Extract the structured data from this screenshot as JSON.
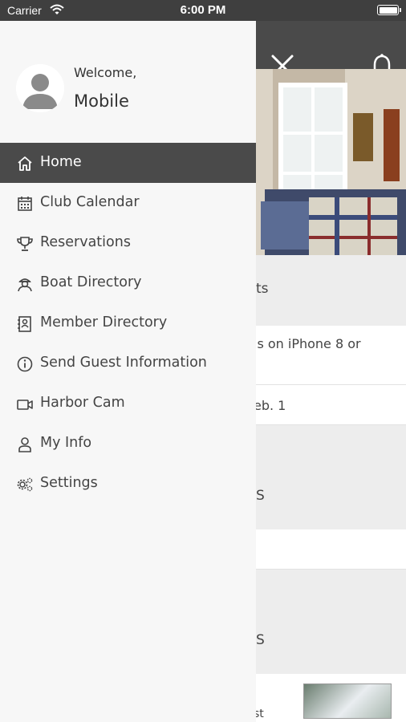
{
  "status_bar": {
    "carrier": "Carrier",
    "time": "6:00 PM"
  },
  "drawer": {
    "welcome": "Welcome,",
    "username": "Mobile",
    "items": [
      {
        "label": "Home",
        "icon": "home-icon",
        "active": true
      },
      {
        "label": "Club Calendar",
        "icon": "calendar-icon"
      },
      {
        "label": "Reservations",
        "icon": "trophy-icon"
      },
      {
        "label": "Boat Directory",
        "icon": "captain-icon"
      },
      {
        "label": "Member Directory",
        "icon": "contact-book-icon"
      },
      {
        "label": "Send Guest Information",
        "icon": "info-icon"
      },
      {
        "label": "Harbor Cam",
        "icon": "video-camera-icon"
      },
      {
        "label": "My Info",
        "icon": "person-icon"
      },
      {
        "label": "Settings",
        "icon": "gears-icon"
      }
    ]
  },
  "background": {
    "section1_title": "ts",
    "row1_text": "is on iPhone 8 or",
    "row2_text": "eb. 1",
    "section2_title": "S",
    "section3_title": "S",
    "row3_text": "st"
  },
  "colors": {
    "header": "#4a4a4a",
    "active_item": "#4a4a4a",
    "drawer_bg": "#f7f7f7"
  }
}
